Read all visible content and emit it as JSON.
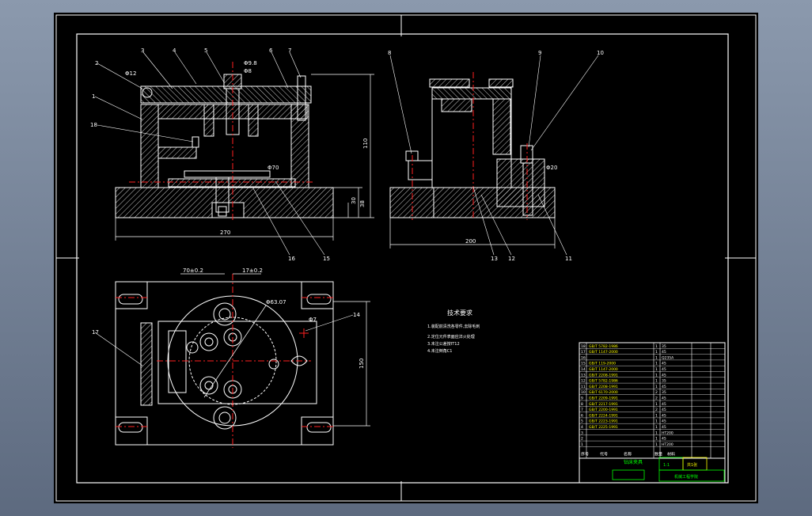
{
  "colors": {
    "sheet": "#000000",
    "outline": "#ffffff",
    "hatch": "#ffffff",
    "center": "#ff2020",
    "dimension": "#ffffff",
    "title_block_green": "#00ff00",
    "table_yellow": "#ffff00"
  },
  "front_view": {
    "balloons": [
      "2",
      "3",
      "4",
      "5",
      "6",
      "7",
      "1",
      "18",
      "16",
      "15"
    ],
    "dims": {
      "d1": "Φ12",
      "d2": "Φ9.8",
      "d3": "Φ8",
      "d4": "Φ70",
      "h1": "110",
      "h2": "30",
      "h3": "38",
      "w": "270"
    }
  },
  "side_view": {
    "balloons": [
      "8",
      "9",
      "10",
      "13",
      "12",
      "11"
    ],
    "dims": {
      "d1": "Φ20",
      "w": "200"
    }
  },
  "top_view": {
    "balloons": [
      "17",
      "14"
    ],
    "dims": {
      "d1": "70±0.2",
      "d2": "17±0.2",
      "d3": "Φ63.07",
      "d4": "Φ7",
      "h": "150"
    }
  },
  "notes": {
    "title": "技术要求",
    "lines": [
      "1.装配前清洗各零件,去除毛刺",
      "2.定位元件表面应淬火处理",
      "3.未注公差按IT12",
      "4.未注倒角C1"
    ]
  },
  "parts_table": {
    "rows": [
      {
        "no": "18",
        "code": "GB/T 5782-1986",
        "qty": "1",
        "mat": "35"
      },
      {
        "no": "17",
        "code": "GB/T 1147-2000",
        "qty": "1",
        "mat": "45"
      },
      {
        "no": "16",
        "code": "",
        "qty": "1",
        "mat": "Q235A"
      },
      {
        "no": "15",
        "code": "GB/T 119-2000",
        "qty": "1",
        "mat": "45"
      },
      {
        "no": "14",
        "code": "GB/T 1147-2000",
        "qty": "1",
        "mat": "45"
      },
      {
        "no": "13",
        "code": "GB/T 2208-1991",
        "qty": "1",
        "mat": "45"
      },
      {
        "no": "12",
        "code": "GB/T 5782-1986",
        "qty": "1",
        "mat": "35"
      },
      {
        "no": "11",
        "code": "GB/T 2208-1991",
        "qty": "1",
        "mat": "45"
      },
      {
        "no": "10",
        "code": "GB/T 6170-2000",
        "qty": "2",
        "mat": "35"
      },
      {
        "no": "9",
        "code": "GB/T 2209-1991",
        "qty": "2",
        "mat": "45"
      },
      {
        "no": "8",
        "code": "GB/T 2217-1991",
        "qty": "1",
        "mat": "45"
      },
      {
        "no": "7",
        "code": "GB/T 2200-1991",
        "qty": "2",
        "mat": "45"
      },
      {
        "no": "6",
        "code": "GB/T 2224-1991",
        "qty": "1",
        "mat": "45"
      },
      {
        "no": "5",
        "code": "GB/T 2223-1991",
        "qty": "1",
        "mat": "45"
      },
      {
        "no": "4",
        "code": "GB/T 2225-1991",
        "qty": "1",
        "mat": "45"
      },
      {
        "no": "3",
        "code": "",
        "qty": "1",
        "mat": "HT200"
      },
      {
        "no": "2",
        "code": "",
        "qty": "1",
        "mat": "45"
      },
      {
        "no": "1",
        "code": "",
        "qty": "1",
        "mat": "HT200"
      }
    ],
    "header": {
      "no": "序号",
      "code": "代号",
      "name": "名称",
      "qty": "数量",
      "mat": "材料"
    }
  },
  "title_block": {
    "drawing_name": "钻床夹具",
    "scale": "1:1",
    "sheet": "共1张",
    "school": "机械工程学院"
  }
}
